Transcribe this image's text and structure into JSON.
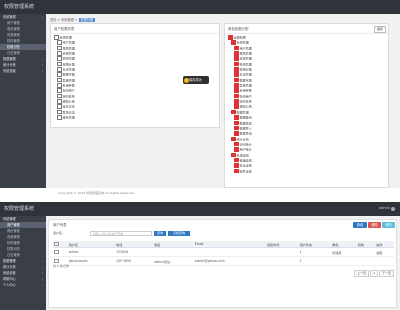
{
  "top_screen": {
    "brand": "权限管理系统",
    "sidebar": [
      {
        "label": "系统管理",
        "group": true
      },
      {
        "label": "用户管理"
      },
      {
        "label": "角色管理"
      },
      {
        "label": "资源管理"
      },
      {
        "label": "机构管理"
      },
      {
        "label": "权限分配",
        "active": true
      },
      {
        "label": "日志管理"
      },
      {
        "label": "数据管理",
        "group": true
      },
      {
        "label": "统计分析",
        "group": true
      },
      {
        "label": "系统设置",
        "group": true
      }
    ],
    "breadcrumb": {
      "prefix": "首页 > 系统管理 >",
      "current": "权限分配"
    },
    "left_panel": {
      "title": "用户权限列表",
      "tree": [
        {
          "label": "系统管理",
          "level": 0
        },
        {
          "label": "用户管理",
          "level": 1
        },
        {
          "label": "角色管理",
          "level": 1
        },
        {
          "label": "资源管理",
          "level": 1
        },
        {
          "label": "机构管理",
          "level": 1
        },
        {
          "label": "权限分配",
          "level": 1
        },
        {
          "label": "日志管理",
          "level": 1
        },
        {
          "label": "数据字典",
          "level": 1
        },
        {
          "label": "菜单管理",
          "level": 1
        },
        {
          "label": "系统参数",
          "level": 1
        },
        {
          "label": "在线用户",
          "level": 1
        },
        {
          "label": "定时任务",
          "level": 1
        },
        {
          "label": "通知公告",
          "level": 1
        },
        {
          "label": "操作日志",
          "level": 1
        },
        {
          "label": "登录日志",
          "level": 1
        },
        {
          "label": "缓存管理",
          "level": 1
        }
      ]
    },
    "right_panel": {
      "title": "角色权限分配",
      "save_label": "保存",
      "tree": [
        {
          "label": "全部权限",
          "level": 0,
          "checked": true
        },
        {
          "label": "系统管理",
          "level": 1,
          "checked": true
        },
        {
          "label": "用户管理",
          "level": 2,
          "checked": true
        },
        {
          "label": "角色管理",
          "level": 2,
          "checked": true
        },
        {
          "label": "资源管理",
          "level": 2,
          "checked": true
        },
        {
          "label": "机构管理",
          "level": 2,
          "checked": true
        },
        {
          "label": "权限分配",
          "level": 2,
          "checked": true
        },
        {
          "label": "日志管理",
          "level": 2,
          "checked": true
        },
        {
          "label": "数据字典",
          "level": 2,
          "checked": true
        },
        {
          "label": "菜单管理",
          "level": 2,
          "checked": true
        },
        {
          "label": "系统参数",
          "level": 2,
          "checked": true
        },
        {
          "label": "在线用户",
          "level": 2,
          "checked": true
        },
        {
          "label": "定时任务",
          "level": 2,
          "checked": true
        },
        {
          "label": "通知公告",
          "level": 2,
          "checked": true
        },
        {
          "label": "数据管理",
          "level": 1,
          "checked": true
        },
        {
          "label": "数据备份",
          "level": 2,
          "checked": true
        },
        {
          "label": "数据恢复",
          "level": 2,
          "checked": true
        },
        {
          "label": "数据导入",
          "level": 2,
          "checked": true
        },
        {
          "label": "数据导出",
          "level": 2,
          "checked": true
        },
        {
          "label": "统计分析",
          "level": 1,
          "checked": true
        },
        {
          "label": "访问统计",
          "level": 2,
          "checked": true
        },
        {
          "label": "用户统计",
          "level": 2,
          "checked": true
        },
        {
          "label": "系统设置",
          "level": 1,
          "checked": true
        },
        {
          "label": "基础设置",
          "level": 2,
          "checked": true
        },
        {
          "label": "安全设置",
          "level": 2,
          "checked": true
        },
        {
          "label": "邮件设置",
          "level": 2,
          "checked": true
        }
      ]
    },
    "toast": "保存成功"
  },
  "gap_text": "Copyright © 2016 权限管理系统 All Rights Reserved",
  "bottom_screen": {
    "brand": "权限管理系统",
    "user": "admin",
    "sidebar": [
      {
        "label": "系统管理",
        "group": true
      },
      {
        "label": "用户管理",
        "active": true
      },
      {
        "label": "角色管理"
      },
      {
        "label": "资源管理"
      },
      {
        "label": "机构管理"
      },
      {
        "label": "权限分配"
      },
      {
        "label": "日志管理"
      },
      {
        "label": "数据管理",
        "group": true
      },
      {
        "label": "统计分析",
        "group": true
      },
      {
        "label": "系统设置",
        "group": true
      },
      {
        "label": "帮助中心",
        "group": true
      },
      {
        "label": "个人中心",
        "group": true
      }
    ],
    "breadcrumb": {
      "prefix": "首页 > 系统管理 >",
      "current": "用户管理"
    },
    "section_title": "用户列表",
    "buttons": {
      "add": "新增",
      "delete": "删除",
      "edit": "修改"
    },
    "search": {
      "label": "用户名：",
      "placeholder": "请输入用户名进行查询",
      "search_btn": "查询",
      "advanced_btn": "高级查询"
    },
    "table": {
      "columns": [
        "",
        "用户名",
        "电话",
        "姓名",
        "Email",
        "创建时间",
        "用户状态",
        "角色",
        "机构",
        "操作"
      ],
      "rows": [
        [
          "",
          "admin",
          "123456",
          "",
          "",
          "",
          "1",
          "管理员",
          "",
          "编辑"
        ],
        [
          "",
          "jianshuquan",
          "159 3694",
          "admin测试",
          "admin@yahoo.com",
          "",
          "1",
          "",
          "",
          ""
        ]
      ]
    },
    "pager_info": "共 2 条记录",
    "pager": [
      "上一页",
      "1",
      "下一页"
    ]
  }
}
